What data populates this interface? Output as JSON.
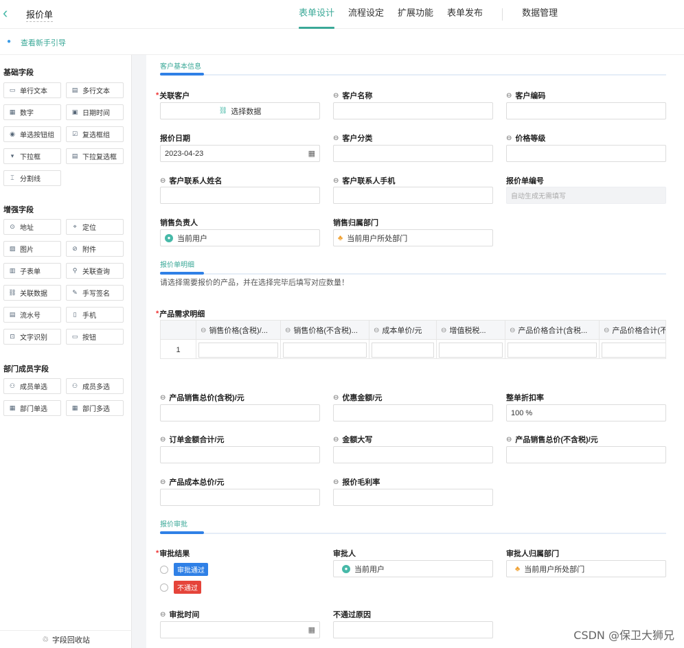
{
  "header": {
    "back_icon": "chevron-left-icon",
    "title": "报价单",
    "tabs": [
      "表单设计",
      "流程设定",
      "扩展功能",
      "表单发布"
    ],
    "data_tab": "数据管理",
    "accent": "#3aa897"
  },
  "guide": {
    "label": "查看新手引导"
  },
  "sidebar": {
    "basic_title": "基础字段",
    "basic": [
      {
        "icon": "▭",
        "label": "单行文本"
      },
      {
        "icon": "▤",
        "label": "多行文本"
      },
      {
        "icon": "▦",
        "label": "数字"
      },
      {
        "icon": "▣",
        "label": "日期时间"
      },
      {
        "icon": "◉",
        "label": "单选按钮组"
      },
      {
        "icon": "☑",
        "label": "复选框组"
      },
      {
        "icon": "▾",
        "label": "下拉框"
      },
      {
        "icon": "▤",
        "label": "下拉复选框"
      },
      {
        "icon": "⌶",
        "label": "分割线"
      }
    ],
    "enhanced_title": "增强字段",
    "enhanced": [
      {
        "icon": "⊙",
        "label": "地址"
      },
      {
        "icon": "⌖",
        "label": "定位"
      },
      {
        "icon": "▨",
        "label": "图片"
      },
      {
        "icon": "⊘",
        "label": "附件"
      },
      {
        "icon": "▥",
        "label": "子表单"
      },
      {
        "icon": "⚲",
        "label": "关联查询"
      },
      {
        "icon": "⛓",
        "label": "关联数据"
      },
      {
        "icon": "✎",
        "label": "手写签名"
      },
      {
        "icon": "▤",
        "label": "流水号"
      },
      {
        "icon": "▯",
        "label": "手机"
      },
      {
        "icon": "⊡",
        "label": "文字识别"
      },
      {
        "icon": "▭",
        "label": "按钮"
      }
    ],
    "dept_title": "部门成员字段",
    "dept": [
      {
        "icon": "⚇",
        "label": "成员单选"
      },
      {
        "icon": "⚇",
        "label": "成员多选"
      },
      {
        "icon": "▦",
        "label": "部门单选"
      },
      {
        "icon": "▦",
        "label": "部门多选"
      }
    ],
    "recycle": "字段回收站"
  },
  "form": {
    "sec1": "客户基本信息",
    "f_customer": "关联客户",
    "f_customer_btn": "选择数据",
    "f_cname": "客户名称",
    "f_ccode": "客户编码",
    "f_date": "报价日期",
    "f_date_val": "2023-04-23",
    "f_ccat": "客户分类",
    "f_price_level": "价格等级",
    "f_contact": "客户联系人姓名",
    "f_phone": "客户联系人手机",
    "f_no": "报价单编号",
    "f_no_ph": "自动生成无需填写",
    "f_sales": "销售负责人",
    "f_sales_val": "当前用户",
    "f_dept": "销售归属部门",
    "f_dept_val": "当前用户所处部门",
    "sec2": "报价单明细",
    "hint": "请选择需要报价的产品，并在选择完毕后填写对应数量！",
    "f_products": "产品需求明细",
    "table_headers": [
      "销售价格(含税)/...",
      "销售价格(不含税)...",
      "成本单价/元",
      "增值税税...",
      "产品价格合计(含税...",
      "产品价格合计(不含"
    ],
    "row_no": "1",
    "f_total_tax": "产品销售总价(含税)/元",
    "f_discount": "优惠金额/元",
    "f_rate": "整单折扣率",
    "f_rate_val": "100 %",
    "f_order_total": "订单金额合计/元",
    "f_upper": "金额大写",
    "f_total_notax": "产品销售总价(不含税)/元",
    "f_cost": "产品成本总价/元",
    "f_margin": "报价毛利率",
    "sec3": "报价审批",
    "f_result": "审批结果",
    "opt_pass": "审批通过",
    "opt_fail": "不通过",
    "f_approver": "审批人",
    "f_approver_val": "当前用户",
    "f_appr_dept": "审批人归属部门",
    "f_appr_dept_val": "当前用户所处部门",
    "f_time": "审批时间",
    "f_reason": "不通过原因"
  },
  "watermark": "CSDN @保卫大狮兄"
}
